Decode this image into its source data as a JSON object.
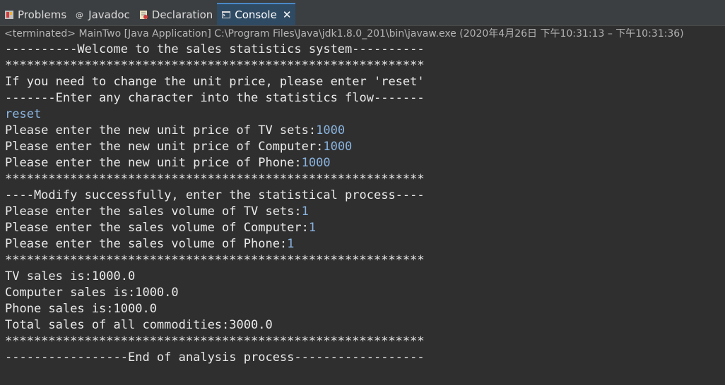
{
  "tabs": [
    {
      "label": "Problems",
      "icon": "problems-icon"
    },
    {
      "label": "Javadoc",
      "icon": "javadoc-icon"
    },
    {
      "label": "Declaration",
      "icon": "declaration-icon"
    },
    {
      "label": "Console",
      "icon": "console-icon",
      "close": "✕"
    }
  ],
  "status": "<terminated> MainTwo [Java Application] C:\\Program Files\\Java\\jdk1.8.0_201\\bin\\javaw.exe  (2020年4月26日 下午10:31:13 – 下午10:31:36)",
  "console": {
    "l0": "----------Welcome to the sales statistics system----------",
    "l1": "**********************************************************",
    "l2": "If you need to change the unit price, please enter 'reset'",
    "l3": "-------Enter any character into the statistics flow-------",
    "l4_in": "reset",
    "l5": "Please enter the new unit price of TV sets:",
    "l5_in": "1000",
    "l6": "Please enter the new unit price of Computer:",
    "l6_in": "1000",
    "l7": "Please enter the new unit price of Phone:",
    "l7_in": "1000",
    "l8": "**********************************************************",
    "l9": "----Modify successfully, enter the statistical process----",
    "l10": "Please enter the sales volume of TV sets:",
    "l10_in": "1",
    "l11": "Please enter the sales volume of Computer:",
    "l11_in": "1",
    "l12": "Please enter the sales volume of Phone:",
    "l12_in": "1",
    "l13": "**********************************************************",
    "l14": "TV sales is:1000.0",
    "l15": "Computer sales is:1000.0",
    "l16": "Phone sales is:1000.0",
    "l17": "Total sales of all commodities:3000.0",
    "l18": "**********************************************************",
    "l19": "-----------------End of analysis process------------------"
  },
  "colors": {
    "background": "#2f2f2f",
    "user_input": "#8ab4e0",
    "active_tab": "#2f4a63"
  }
}
